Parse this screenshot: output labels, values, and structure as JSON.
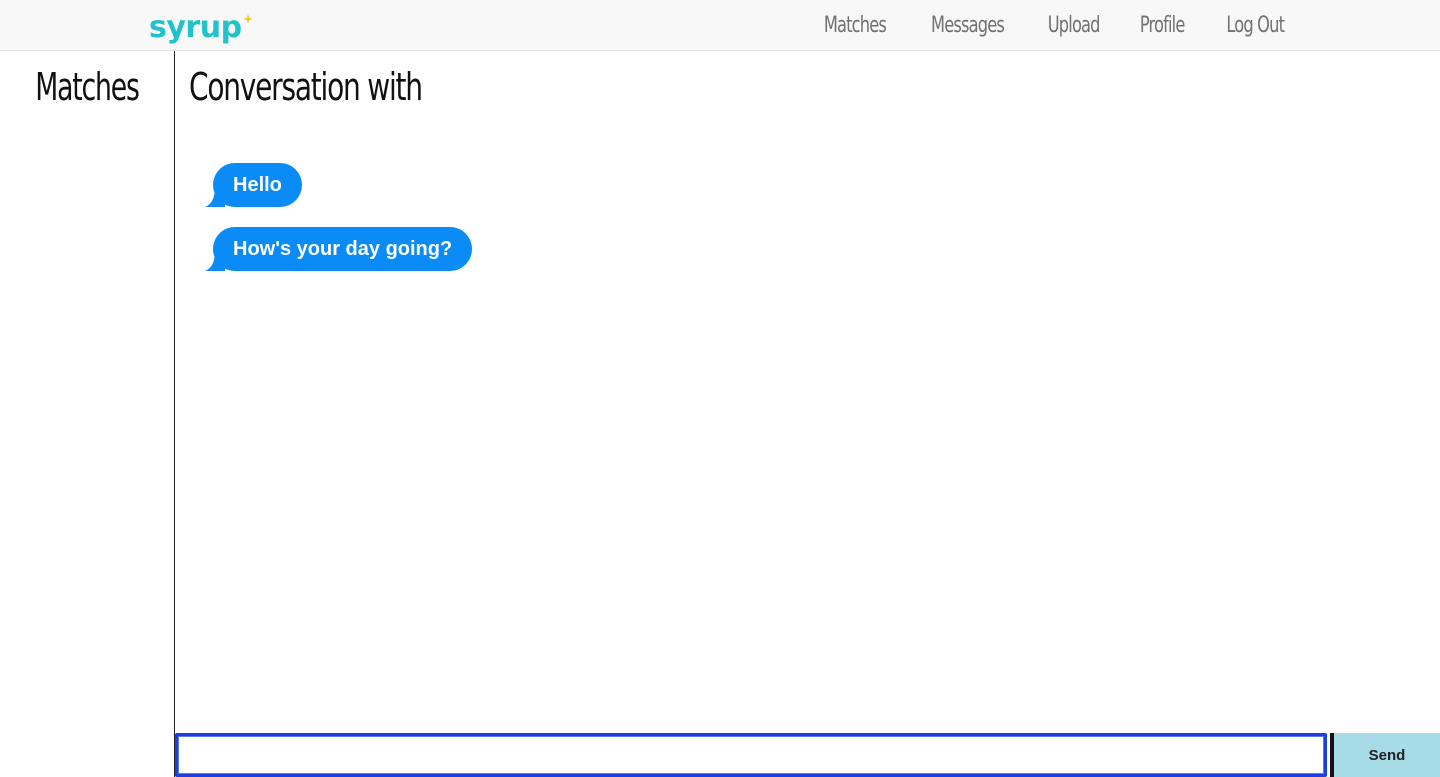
{
  "brand": {
    "name": "syrup",
    "color": "#1fc3c9",
    "accent_color": "#f5c400"
  },
  "nav": {
    "items": [
      {
        "label": "Matches"
      },
      {
        "label": "Messages"
      },
      {
        "label": "Upload"
      },
      {
        "label": "Profile"
      },
      {
        "label": "Log Out"
      }
    ]
  },
  "sidebar": {
    "title": "Matches"
  },
  "conversation": {
    "title": "Conversation with",
    "messages": [
      {
        "text": "Hello"
      },
      {
        "text": "How's your day going?"
      }
    ],
    "bubble_color": "#0a8bf5"
  },
  "composer": {
    "value": "",
    "placeholder": "",
    "send_label": "Send"
  }
}
